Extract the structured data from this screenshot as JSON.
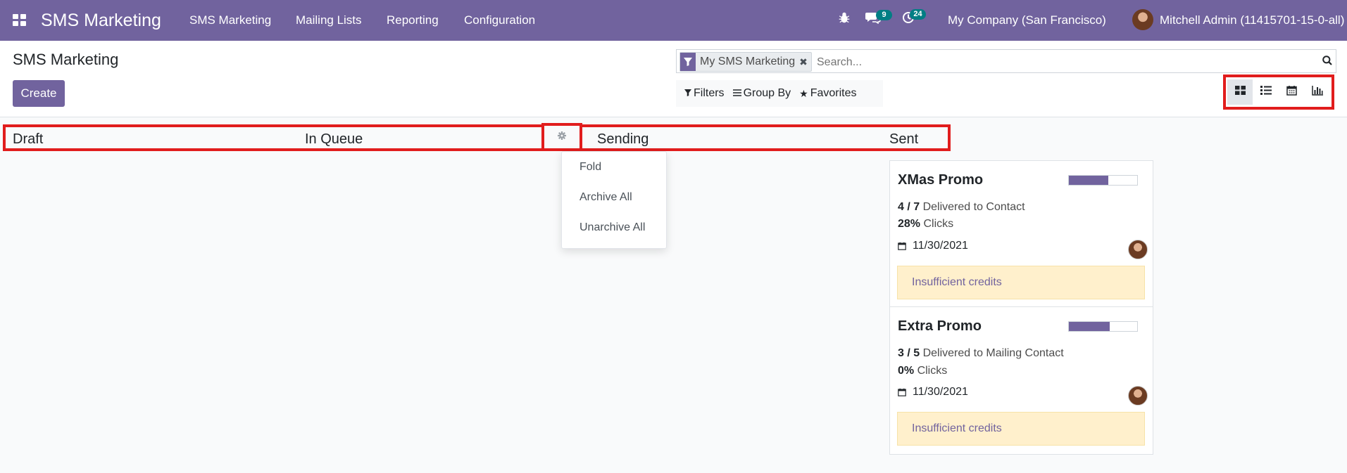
{
  "navbar": {
    "brand": "SMS Marketing",
    "menu": [
      "SMS Marketing",
      "Mailing Lists",
      "Reporting",
      "Configuration"
    ],
    "messages_count": "9",
    "activities_count": "24",
    "company": "My Company (San Francisco)",
    "user": "Mitchell Admin (11415701-15-0-all)",
    "bg_color": "#71639e"
  },
  "control_panel": {
    "title": "SMS Marketing",
    "create_label": "Create",
    "facet_label": "My SMS Marketing",
    "search_placeholder": "Search...",
    "filters_label": "Filters",
    "group_by_label": "Group By",
    "favorites_label": "Favorites",
    "views": [
      "kanban-icon",
      "list-icon",
      "calendar-icon",
      "graph-icon"
    ],
    "active_view": "kanban"
  },
  "columns": [
    "Draft",
    "In Queue",
    "Sending",
    "Sent"
  ],
  "dropdown": [
    "Fold",
    "Archive All",
    "Unarchive All"
  ],
  "cards": [
    {
      "title": "XMas Promo",
      "progress": 0.58,
      "ratio": "4 / 7",
      "ratio_label": " Delivered to Contact",
      "clicks": "28%",
      "clicks_label": " Clicks",
      "date": "11/30/2021",
      "warning": "Insufficient credits"
    },
    {
      "title": "Extra Promo",
      "progress": 0.6,
      "ratio": "3 / 5",
      "ratio_label": " Delivered to Mailing Contact",
      "clicks": "0%",
      "clicks_label": " Clicks",
      "date": "11/30/2021",
      "warning": "Insufficient credits"
    }
  ]
}
